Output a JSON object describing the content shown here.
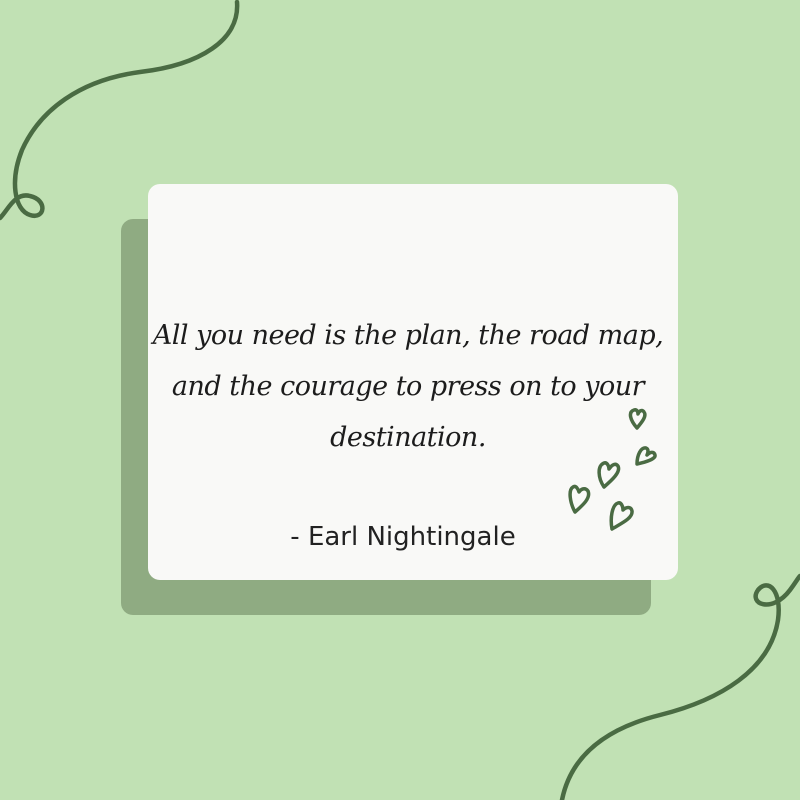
{
  "quote": {
    "text": "All you need is the plan, the road map, and the courage to press on to your destination."
  },
  "author": {
    "text": "- Earl Nightingale"
  },
  "colors": {
    "background": "#c1e1b4",
    "card": "#f9f9f7",
    "card_shadow": "#8fab82",
    "accent": "#4a6b43"
  },
  "decorations": [
    "swirl-line",
    "hearts-cluster"
  ]
}
